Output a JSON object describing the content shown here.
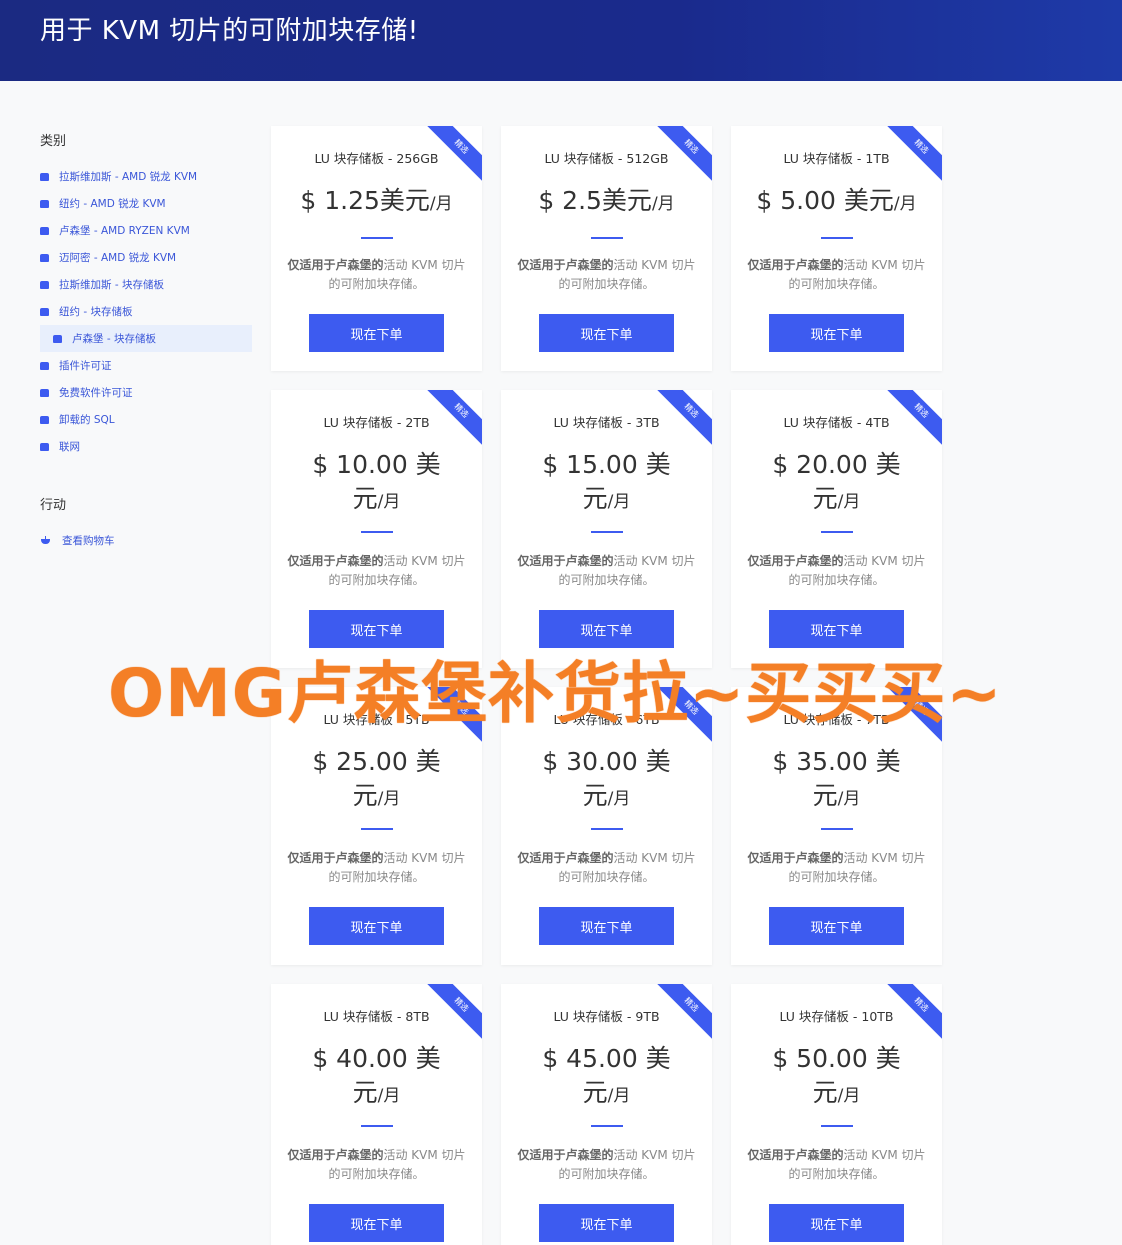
{
  "header": {
    "title": "用于 KVM 切片的可附加块存储!"
  },
  "sidebar": {
    "categories_heading": "类别",
    "items": [
      {
        "label": "拉斯维加斯 - AMD 锐龙 KVM"
      },
      {
        "label": "纽约 - AMD 锐龙 KVM"
      },
      {
        "label": "卢森堡 - AMD RYZEN KVM"
      },
      {
        "label": "迈阿密 - AMD 锐龙 KVM"
      },
      {
        "label": "拉斯维加斯 - 块存储板"
      },
      {
        "label": "纽约 - 块存储板"
      },
      {
        "label": "卢森堡 - 块存储板"
      },
      {
        "label": "插件许可证"
      },
      {
        "label": "免费软件许可证"
      },
      {
        "label": "卸载的 SQL"
      },
      {
        "label": "联网"
      }
    ],
    "actions_heading": "行动",
    "actions": [
      {
        "label": "查看购物车"
      }
    ]
  },
  "common": {
    "ribbon": "精选",
    "desc_pre": "仅适用于",
    "desc_bold1": "卢森堡的",
    "desc_post": "活动 KVM 切片的可附加块存储。",
    "button": "现在下单",
    "period": "/月"
  },
  "cards": [
    {
      "title": "LU 块存储板 - 256GB",
      "price": "$ 1.25美元"
    },
    {
      "title": "LU 块存储板 - 512GB",
      "price": "$ 2.5美元"
    },
    {
      "title": "LU 块存储板 - 1TB",
      "price": "$ 5.00 美元"
    },
    {
      "title": "LU 块存储板 - 2TB",
      "price": "$ 10.00 美元"
    },
    {
      "title": "LU 块存储板 - 3TB",
      "price": "$ 15.00 美元"
    },
    {
      "title": "LU 块存储板 - 4TB",
      "price": "$ 20.00 美元"
    },
    {
      "title": "LU 块存储板 - 5TB",
      "price": "$ 25.00 美元"
    },
    {
      "title": "LU 块存储板 - 6TB",
      "price": "$ 30.00 美元"
    },
    {
      "title": "LU 块存储板 - 7TB",
      "price": "$ 35.00 美元"
    },
    {
      "title": "LU 块存储板 - 8TB",
      "price": "$ 40.00 美元"
    },
    {
      "title": "LU 块存储板 - 9TB",
      "price": "$ 45.00 美元"
    },
    {
      "title": "LU 块存储板 - 10TB",
      "price": "$ 50.00 美元"
    }
  ],
  "overlay": {
    "text": "OMG卢森堡补货拉~买买买~"
  },
  "colors": {
    "accent": "#3d5bf0",
    "header": "#1b2a82",
    "overlay": "#f47f26"
  }
}
